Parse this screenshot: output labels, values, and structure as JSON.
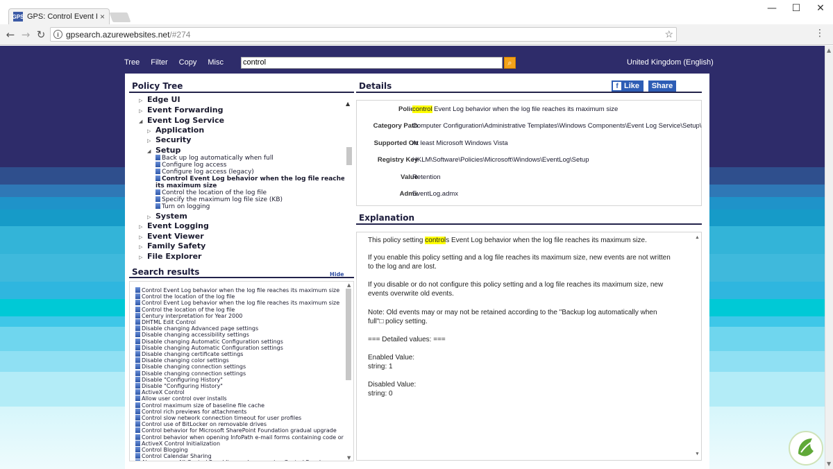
{
  "browser": {
    "tab_title": "GPS: Control Event Log b",
    "favicon_text": "GPS",
    "url_host": "gpsearch.azurewebsites.net",
    "url_path": "/#274",
    "min_label": "—",
    "max_label": "☐",
    "close_label": "✕"
  },
  "site_menu": {
    "items": [
      "Tree",
      "Filter",
      "Copy",
      "Misc"
    ],
    "search_value": "control",
    "language": "United Kingdom (English)"
  },
  "policy_tree": {
    "title": "Policy Tree",
    "rows": [
      {
        "text": "Edge UI",
        "level": 1,
        "arrow": "▷"
      },
      {
        "text": "Event Forwarding",
        "level": 1,
        "arrow": "▷"
      },
      {
        "text": "Event Log Service",
        "level": 1,
        "arrow": "◢"
      },
      {
        "text": "Application",
        "level": 2,
        "arrow": "▷"
      },
      {
        "text": "Security",
        "level": 2,
        "arrow": "▷"
      },
      {
        "text": "Setup",
        "level": 2,
        "arrow": "◢"
      },
      {
        "text": "Back up log automatically when full",
        "level": 3
      },
      {
        "text": "Configure log access",
        "level": 3
      },
      {
        "text": "Configure log access (legacy)",
        "level": 3
      },
      {
        "text": "Control Event Log behavior when the log file reaches",
        "level": 3,
        "bold": true
      },
      {
        "text": "its maximum size",
        "level": 3,
        "bold": true,
        "continuation": true
      },
      {
        "text": "Control the location of the log file",
        "level": 3
      },
      {
        "text": "Specify the maximum log file size (KB)",
        "level": 3
      },
      {
        "text": "Turn on logging",
        "level": 3
      },
      {
        "text": "System",
        "level": 2,
        "arrow": "▷"
      },
      {
        "text": "Event Logging",
        "level": 1,
        "arrow": "▷"
      },
      {
        "text": "Event Viewer",
        "level": 1,
        "arrow": "▷"
      },
      {
        "text": "Family Safety",
        "level": 1,
        "arrow": "▷"
      },
      {
        "text": "File Explorer",
        "level": 1,
        "arrow": "▷"
      }
    ]
  },
  "search_results": {
    "title": "Search results",
    "hide_label": "Hide",
    "items": [
      "Control Event Log behavior when the log file reaches its maximum size",
      "Control the location of the log file",
      "Control Event Log behavior when the log file reaches its maximum size",
      "Control the location of the log file",
      "Century interpretation for Year 2000",
      "DHTML Edit Control",
      "Disable changing Advanced page settings",
      "Disable changing accessibility settings",
      "Disable changing Automatic Configuration settings",
      "Disable changing Automatic Configuration settings",
      "Disable changing certificate settings",
      "Disable changing color settings",
      "Disable changing connection settings",
      "Disable changing connection settings",
      "Disable \"Configuring History\"",
      "Disable \"Configuring History\"",
      "ActiveX Control",
      "Allow user control over installs",
      "Control maximum size of baseline file cache",
      "Control rich previews for attachments",
      "Control slow network connection timeout for user profiles",
      "Control use of BitLocker on removable drives",
      "Control behavior for Microsoft SharePoint Foundation gradual upgrade",
      "Control behavior when opening InfoPath e-mail forms containing code or",
      "ActiveX Control Initialization",
      "Control Blogging",
      "Control Calendar Sharing",
      "Always open All Control Panel Items when opening Control Panel"
    ]
  },
  "details": {
    "title": "Details",
    "like_label": "Like",
    "share_label": "Share",
    "rows": [
      {
        "label": "Policy",
        "highlight": "control",
        "value": " Event Log behavior when the log file reaches its maximum size"
      },
      {
        "label": "Category Path",
        "highlight": "",
        "value": "Computer Configuration\\Administrative Templates\\Windows Components\\Event Log Service\\Setup\\"
      },
      {
        "label": "Supported On",
        "highlight": "",
        "value": "At least Microsoft Windows Vista"
      },
      {
        "label": "Registry Key",
        "highlight": "",
        "value": "HKLM\\Software\\Policies\\Microsoft\\Windows\\EventLog\\Setup"
      },
      {
        "label": "Value",
        "highlight": "",
        "value": "Retention"
      },
      {
        "label": "Admx",
        "highlight": "",
        "value": "EventLog.admx"
      }
    ]
  },
  "explanation": {
    "title": "Explanation",
    "line1_pre": "This policy setting ",
    "line1_hl": "control",
    "line1_post": "s Event Log behavior when the log file reaches its maximum size.",
    "lines": [
      "If you enable this policy setting and a log file reaches its maximum size, new events are not written",
      "to the log and are lost.",
      "If you disable or do not configure this policy setting and a log file reaches its maximum size, new",
      "events overwrite old events.",
      "Note: Old events may or may not be retained according to the \"Backup log automatically when",
      "full\"□ policy setting.",
      "=== Detailed values: ===",
      "Enabled Value:",
      "string: 1",
      "Disabled Value:",
      "string: 0"
    ]
  }
}
